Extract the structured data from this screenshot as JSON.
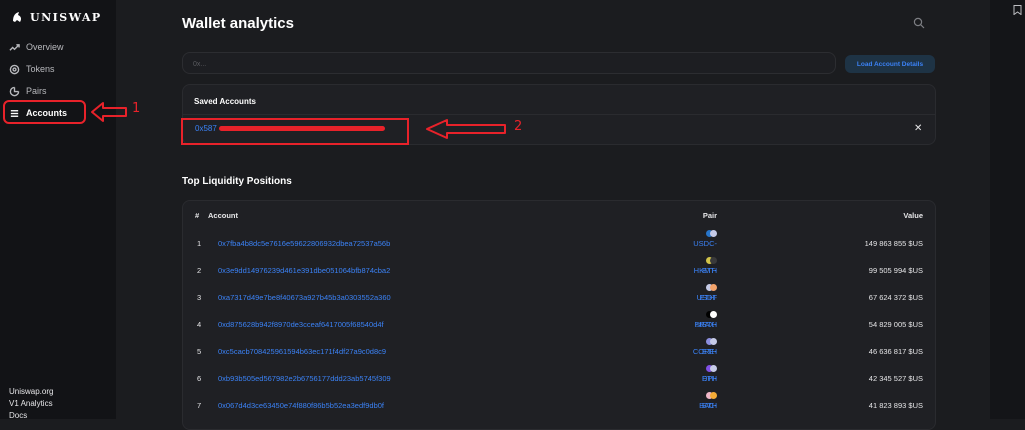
{
  "brand": {
    "name": "UNISWAP"
  },
  "nav": {
    "items": [
      {
        "label": "Overview",
        "icon": "trend-icon"
      },
      {
        "label": "Tokens",
        "icon": "disc-icon"
      },
      {
        "label": "Pairs",
        "icon": "pie-icon"
      },
      {
        "label": "Accounts",
        "icon": "list-icon",
        "active": true
      }
    ]
  },
  "footer": {
    "links": [
      "Uniswap.org",
      "V1 Analytics",
      "Docs"
    ]
  },
  "annotations": {
    "one": "1",
    "two": "2"
  },
  "header": {
    "title": "Wallet analytics"
  },
  "search": {
    "placeholder": "0x...",
    "button_label": "Load Account Details"
  },
  "saved": {
    "title": "Saved Accounts",
    "address_prefix": "0x587"
  },
  "positions": {
    "title": "Top Liquidity Positions",
    "columns": {
      "index": "#",
      "account": "Account",
      "pair": "Pair",
      "value": "Value"
    },
    "rows": [
      {
        "index": "1",
        "account": "0x7fba4b8dc5e7616e59622806932dbea72537a56b",
        "pair": "USDC-ETH",
        "value": "149 863 855 $US",
        "colors": [
          "#2775ca",
          "#c6cbe8"
        ]
      },
      {
        "index": "2",
        "account": "0x3e9dd14976239d461e391dbe051064bfb874cba2",
        "pair": "HKMT-USDT",
        "value": "99 505 994 $US",
        "colors": [
          "#d2c44a",
          "#3a3a3a"
        ]
      },
      {
        "index": "3",
        "account": "0xa7317d49e7be8f40673a927b45b3a0303552a360",
        "pair": "ETH-stETH",
        "value": "67 624 372 $US",
        "colors": [
          "#c6cbe8",
          "#f3a36b"
        ]
      },
      {
        "index": "4",
        "account": "0xd875628b942f8970de3cceaf6417005f68540d4f",
        "pair": "FRAX-ETH",
        "value": "54 829 005 $US",
        "colors": [
          "#000000",
          "#ffffff"
        ]
      },
      {
        "index": "5",
        "account": "0xc5cacb708425961594b63ec171f4df27a9c0d8c9",
        "pair": "CORE-ETH",
        "value": "46 636 817 $US",
        "colors": [
          "#8c8fe0",
          "#c6cbe8"
        ]
      },
      {
        "index": "6",
        "account": "0xb93b505ed567982e2b6756177ddd23ab5745f309",
        "pair": "DPI-ETH",
        "value": "42 345 527 $US",
        "colors": [
          "#8150e6",
          "#c6cbe8"
        ]
      },
      {
        "index": "7",
        "account": "0x067d4d3ce63450e74f880f86b5b52ea3edf9db0f",
        "pair": "BAC-DAI",
        "value": "41 823 893 $US",
        "colors": [
          "#f0b7c8",
          "#f5ac37"
        ]
      }
    ]
  }
}
